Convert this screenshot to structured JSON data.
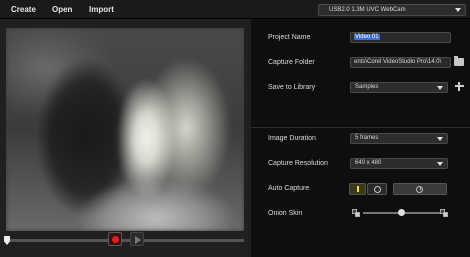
{
  "menu": {
    "items": [
      {
        "label": "Create"
      },
      {
        "label": "Open"
      },
      {
        "label": "Import"
      }
    ]
  },
  "device": {
    "selected": "USB2.0 1.3M UVC WebCam"
  },
  "settings": {
    "project_name": {
      "label": "Project Name",
      "value": "Video 01"
    },
    "capture_folder": {
      "label": "Capture Folder",
      "value": "ents\\Corel VideoStudio Pro\\14.0\\"
    },
    "save_to_library": {
      "label": "Save to Library",
      "value": "Samples"
    },
    "image_duration": {
      "label": "Image Duration",
      "value": "5 frames"
    },
    "capture_resolution": {
      "label": "Capture Resolution",
      "value": "640 x 480"
    },
    "auto_capture": {
      "label": "Auto Capture"
    },
    "onion_skin": {
      "label": "Onion Skin",
      "level": 0.55
    }
  },
  "playback": {
    "position": 0.0
  },
  "colors": {
    "record": "#e02020",
    "selection": "#3a6fd8",
    "auto_capture_on": "#e8e050"
  }
}
